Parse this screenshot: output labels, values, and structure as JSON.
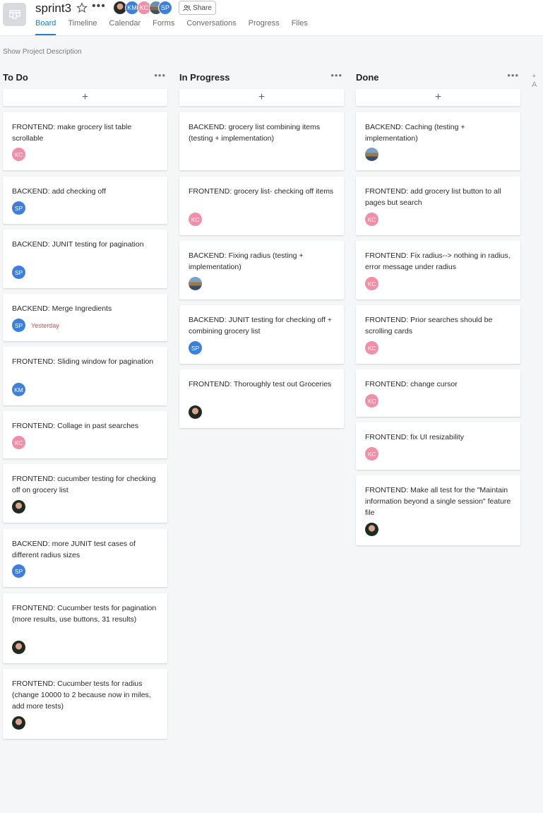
{
  "header": {
    "title": "sprint3",
    "share_label": "Share",
    "members": [
      {
        "initials": "",
        "kind": "photo"
      },
      {
        "initials": "KM",
        "color": "#3d7fd9"
      },
      {
        "initials": "KC",
        "color": "#f28fa8"
      },
      {
        "initials": "",
        "kind": "photo-land"
      },
      {
        "initials": "SP",
        "color": "#3d7fd9"
      }
    ],
    "tabs": [
      "Board",
      "Timeline",
      "Calendar",
      "Forms",
      "Conversations",
      "Progress",
      "Files"
    ],
    "active_tab": "Board"
  },
  "show_description": "Show Project Description",
  "add_column": "+ A",
  "columns": [
    {
      "title": "To Do",
      "cards": [
        {
          "text": "FRONTEND: make grocery list table scrollable",
          "assignee": "KC"
        },
        {
          "text": "BACKEND: add checking off",
          "assignee": "SP"
        },
        {
          "text": "BACKEND: JUNIT testing for pagination",
          "assignee": "SP"
        },
        {
          "text": "BACKEND: Merge Ingredients",
          "assignee": "SP",
          "due": "Yesterday"
        },
        {
          "text": "FRONTEND: Sliding window for pagination",
          "assignee": "KM"
        },
        {
          "text": "FRONTEND: Collage in past searches",
          "assignee": "KC"
        },
        {
          "text": "FRONTEND: cucumber testing for checking off on grocery list",
          "assignee": "photo"
        },
        {
          "text": "BACKEND: more JUNIT test cases of different radius sizes",
          "assignee": "SP"
        },
        {
          "text": "FRONTEND: Cucumber tests for pagination (more results, use buttons, 31 results)",
          "assignee": "photo"
        },
        {
          "text": "FRONTEND: Cucumber tests for radius (change 10000 to 2 because now in miles, add more tests)",
          "assignee": "photo"
        }
      ]
    },
    {
      "title": "In Progress",
      "cards": [
        {
          "text": "BACKEND: grocery list combining items (testing + implementation)",
          "assignee": ""
        },
        {
          "text": "FRONTEND: grocery list- checking off items",
          "assignee": "KC"
        },
        {
          "text": "BACKEND: Fixing radius (testing + implementation)",
          "assignee": "photo-land"
        },
        {
          "text": "BACKEND: JUNIT testing for checking off + combining grocery list",
          "assignee": "SP"
        },
        {
          "text": "FRONTEND: Thoroughly test out Groceries",
          "assignee": "photo"
        }
      ]
    },
    {
      "title": "Done",
      "cards": [
        {
          "text": "BACKEND: Caching (testing + implementation)",
          "assignee": "photo-land"
        },
        {
          "text": "FRONTEND: add grocery list button to all pages but search",
          "assignee": "KC"
        },
        {
          "text": "FRONTEND: Fix radius--> nothing in radius, error message under radius",
          "assignee": "KC"
        },
        {
          "text": "FRONTEND: Prior searches should be scrolling cards",
          "assignee": "KC"
        },
        {
          "text": "FRONTEND: change cursor",
          "assignee": "KC"
        },
        {
          "text": "FRONTEND: fix UI resizability",
          "assignee": "KC"
        },
        {
          "text": "FRONTEND: Make all test for the \"Maintain information beyond a single session\" feature file",
          "assignee": "photo"
        }
      ]
    }
  ]
}
